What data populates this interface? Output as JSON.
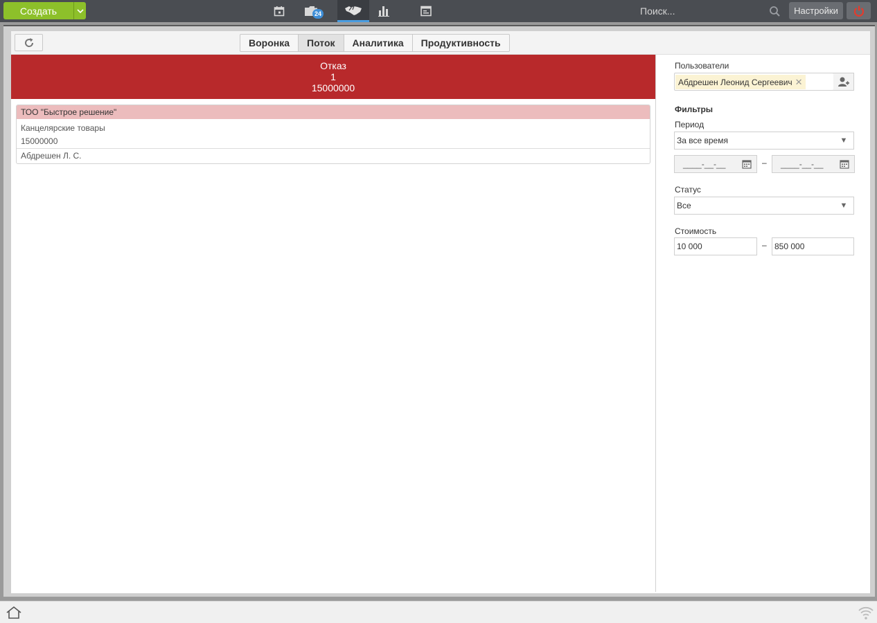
{
  "topbar": {
    "create_label": "Создать",
    "badge_count": "24",
    "search_placeholder": "Поиск...",
    "settings_label": "Настройки",
    "nav_icons": [
      "calendar-icon",
      "folder-icon",
      "handshake-icon",
      "bar-chart-icon",
      "browser-window-icon"
    ],
    "accent_color": "#8dc02a",
    "power_color": "#e53b2c"
  },
  "toolbar": {
    "tabs": [
      {
        "label": "Воронка",
        "active": false
      },
      {
        "label": "Поток",
        "active": true
      },
      {
        "label": "Аналитика",
        "active": false
      },
      {
        "label": "Продуктивность",
        "active": false
      }
    ]
  },
  "stage": {
    "name": "Отказ",
    "count": "1",
    "amount": "15000000",
    "color": "#b8292b"
  },
  "deal": {
    "company": "ТОО \"Быстрое решение\"",
    "product": "Канцелярские товары",
    "amount": "15000000",
    "owner": "Абдрешен Л. С."
  },
  "filters": {
    "users_label": "Пользователи",
    "selected_user": "Абдрешен Леонид Сергеевич",
    "filters_heading": "Фильтры",
    "period_label": "Период",
    "period_value": "За все время",
    "date_from_mask": "____-__-__",
    "date_to_mask": "____-__-__",
    "date_separator": "–",
    "status_label": "Статус",
    "status_value": "Все",
    "cost_label": "Стоимость",
    "cost_from": "10 000",
    "cost_to": "850 000",
    "cost_separator": "–"
  }
}
